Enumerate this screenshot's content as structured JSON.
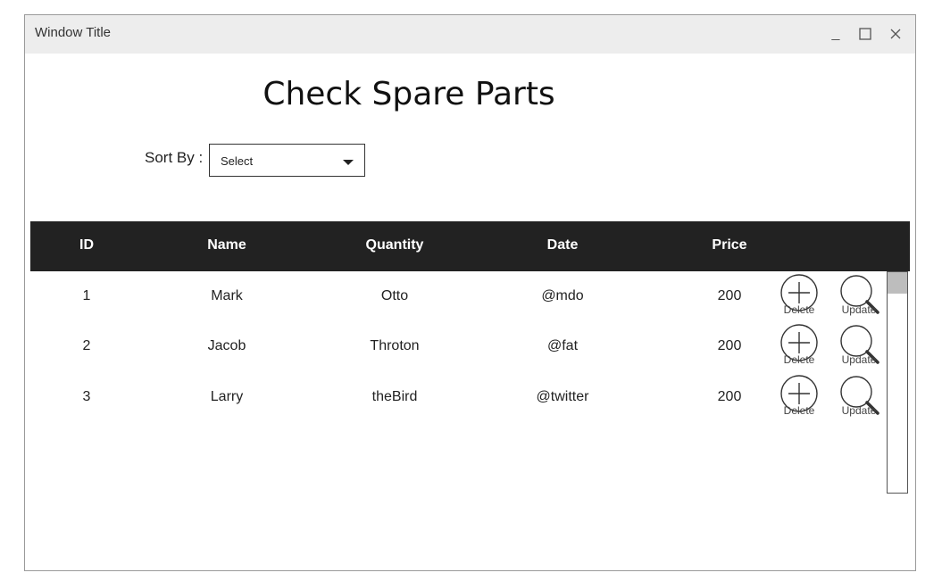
{
  "window": {
    "title": "Window Title"
  },
  "page": {
    "title": "Check Spare Parts"
  },
  "sort": {
    "label": "Sort By :",
    "selected": "Select"
  },
  "table": {
    "headers": [
      "ID",
      "Name",
      "Quantity",
      "Date",
      "Price"
    ],
    "rows": [
      {
        "id": "1",
        "name": "Mark",
        "quantity": "Otto",
        "date": "@mdo",
        "price": "200",
        "delete_label": "Delete",
        "update_label": "Update"
      },
      {
        "id": "2",
        "name": "Jacob",
        "quantity": "Throton",
        "date": "@fat",
        "price": "200",
        "delete_label": "Delete",
        "update_label": "Update"
      },
      {
        "id": "3",
        "name": "Larry",
        "quantity": "theBird",
        "date": "@twitter",
        "price": "200",
        "delete_label": "Delete",
        "update_label": "Update"
      }
    ]
  },
  "icons": {
    "delete": "plus-circle-icon",
    "update": "magnifier-icon"
  },
  "colors": {
    "header_bg": "#222222",
    "titlebar_bg": "#ededed"
  }
}
